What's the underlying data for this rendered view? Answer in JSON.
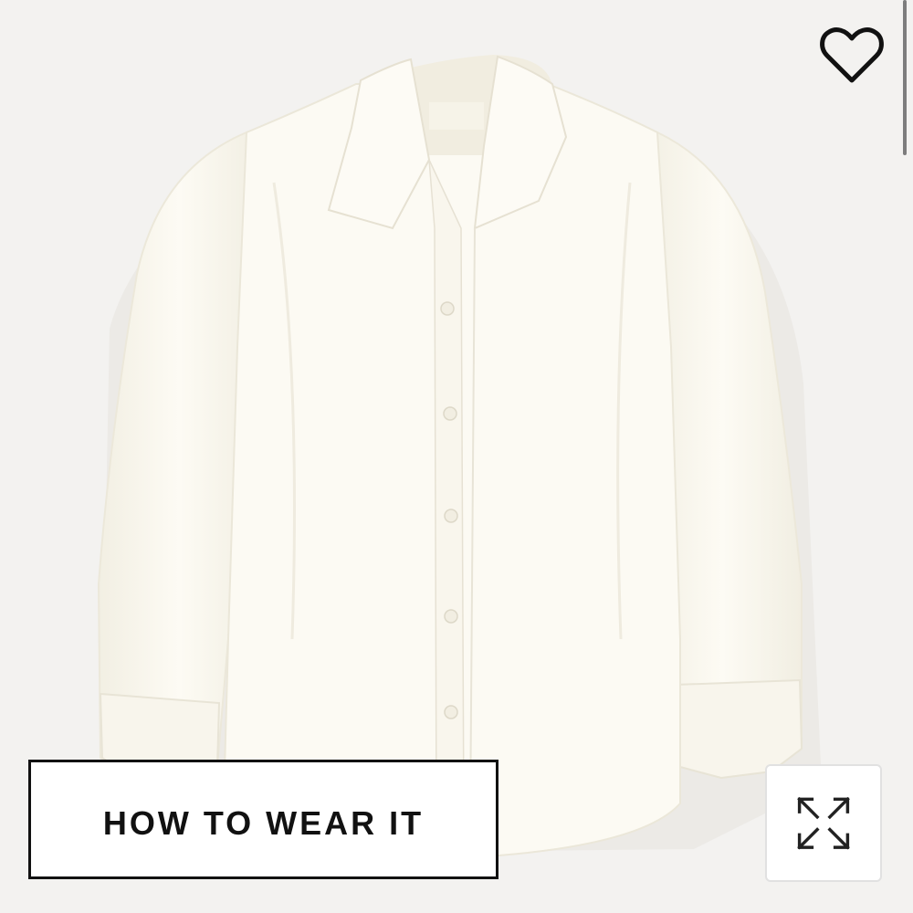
{
  "product_image": {
    "icon": "white-button-up-shirt-photo",
    "background_color": "#f3f2f0",
    "shirt_color": "#fbf9f1"
  },
  "favorite_button": {
    "icon": "heart-outline-icon"
  },
  "how_to_wear_button": {
    "label": "HOW TO WEAR IT"
  },
  "expand_button": {
    "icon": "expand-arrows-icon"
  }
}
